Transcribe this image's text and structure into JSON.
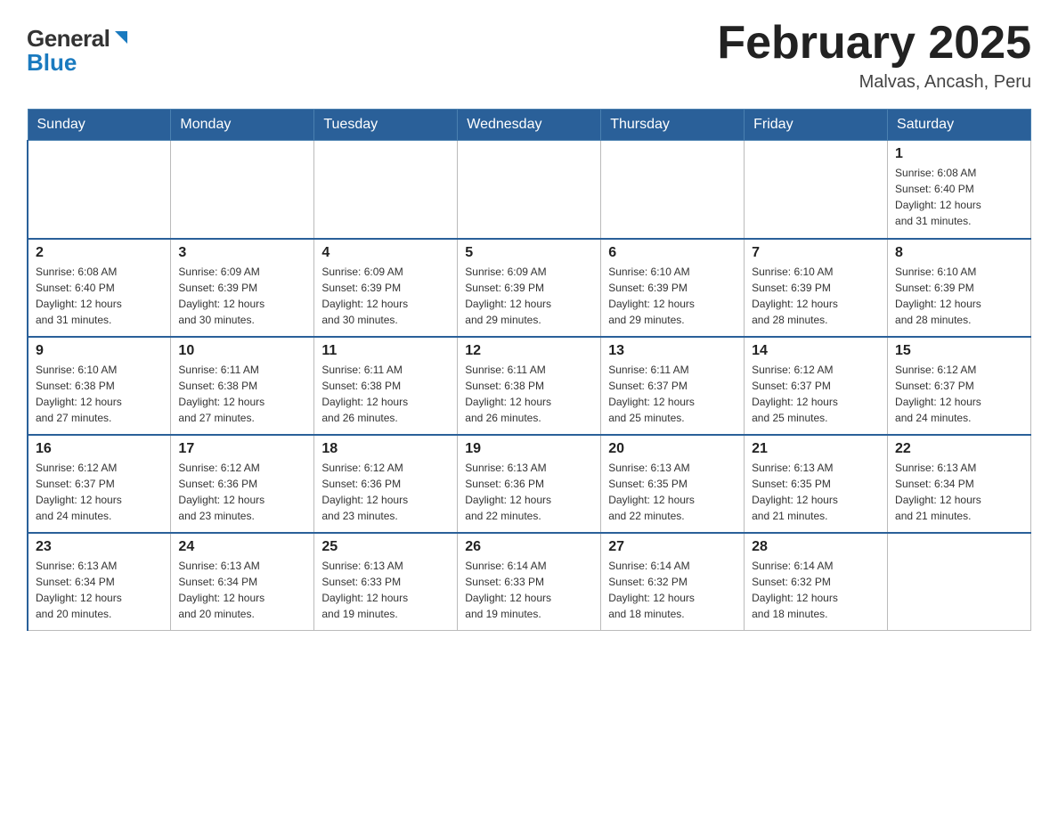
{
  "header": {
    "logo_line1": "General",
    "logo_line2": "Blue",
    "month_title": "February 2025",
    "location": "Malvas, Ancash, Peru"
  },
  "weekdays": [
    "Sunday",
    "Monday",
    "Tuesday",
    "Wednesday",
    "Thursday",
    "Friday",
    "Saturday"
  ],
  "weeks": [
    [
      {
        "day": "",
        "info": ""
      },
      {
        "day": "",
        "info": ""
      },
      {
        "day": "",
        "info": ""
      },
      {
        "day": "",
        "info": ""
      },
      {
        "day": "",
        "info": ""
      },
      {
        "day": "",
        "info": ""
      },
      {
        "day": "1",
        "info": "Sunrise: 6:08 AM\nSunset: 6:40 PM\nDaylight: 12 hours\nand 31 minutes."
      }
    ],
    [
      {
        "day": "2",
        "info": "Sunrise: 6:08 AM\nSunset: 6:40 PM\nDaylight: 12 hours\nand 31 minutes."
      },
      {
        "day": "3",
        "info": "Sunrise: 6:09 AM\nSunset: 6:39 PM\nDaylight: 12 hours\nand 30 minutes."
      },
      {
        "day": "4",
        "info": "Sunrise: 6:09 AM\nSunset: 6:39 PM\nDaylight: 12 hours\nand 30 minutes."
      },
      {
        "day": "5",
        "info": "Sunrise: 6:09 AM\nSunset: 6:39 PM\nDaylight: 12 hours\nand 29 minutes."
      },
      {
        "day": "6",
        "info": "Sunrise: 6:10 AM\nSunset: 6:39 PM\nDaylight: 12 hours\nand 29 minutes."
      },
      {
        "day": "7",
        "info": "Sunrise: 6:10 AM\nSunset: 6:39 PM\nDaylight: 12 hours\nand 28 minutes."
      },
      {
        "day": "8",
        "info": "Sunrise: 6:10 AM\nSunset: 6:39 PM\nDaylight: 12 hours\nand 28 minutes."
      }
    ],
    [
      {
        "day": "9",
        "info": "Sunrise: 6:10 AM\nSunset: 6:38 PM\nDaylight: 12 hours\nand 27 minutes."
      },
      {
        "day": "10",
        "info": "Sunrise: 6:11 AM\nSunset: 6:38 PM\nDaylight: 12 hours\nand 27 minutes."
      },
      {
        "day": "11",
        "info": "Sunrise: 6:11 AM\nSunset: 6:38 PM\nDaylight: 12 hours\nand 26 minutes."
      },
      {
        "day": "12",
        "info": "Sunrise: 6:11 AM\nSunset: 6:38 PM\nDaylight: 12 hours\nand 26 minutes."
      },
      {
        "day": "13",
        "info": "Sunrise: 6:11 AM\nSunset: 6:37 PM\nDaylight: 12 hours\nand 25 minutes."
      },
      {
        "day": "14",
        "info": "Sunrise: 6:12 AM\nSunset: 6:37 PM\nDaylight: 12 hours\nand 25 minutes."
      },
      {
        "day": "15",
        "info": "Sunrise: 6:12 AM\nSunset: 6:37 PM\nDaylight: 12 hours\nand 24 minutes."
      }
    ],
    [
      {
        "day": "16",
        "info": "Sunrise: 6:12 AM\nSunset: 6:37 PM\nDaylight: 12 hours\nand 24 minutes."
      },
      {
        "day": "17",
        "info": "Sunrise: 6:12 AM\nSunset: 6:36 PM\nDaylight: 12 hours\nand 23 minutes."
      },
      {
        "day": "18",
        "info": "Sunrise: 6:12 AM\nSunset: 6:36 PM\nDaylight: 12 hours\nand 23 minutes."
      },
      {
        "day": "19",
        "info": "Sunrise: 6:13 AM\nSunset: 6:36 PM\nDaylight: 12 hours\nand 22 minutes."
      },
      {
        "day": "20",
        "info": "Sunrise: 6:13 AM\nSunset: 6:35 PM\nDaylight: 12 hours\nand 22 minutes."
      },
      {
        "day": "21",
        "info": "Sunrise: 6:13 AM\nSunset: 6:35 PM\nDaylight: 12 hours\nand 21 minutes."
      },
      {
        "day": "22",
        "info": "Sunrise: 6:13 AM\nSunset: 6:34 PM\nDaylight: 12 hours\nand 21 minutes."
      }
    ],
    [
      {
        "day": "23",
        "info": "Sunrise: 6:13 AM\nSunset: 6:34 PM\nDaylight: 12 hours\nand 20 minutes."
      },
      {
        "day": "24",
        "info": "Sunrise: 6:13 AM\nSunset: 6:34 PM\nDaylight: 12 hours\nand 20 minutes."
      },
      {
        "day": "25",
        "info": "Sunrise: 6:13 AM\nSunset: 6:33 PM\nDaylight: 12 hours\nand 19 minutes."
      },
      {
        "day": "26",
        "info": "Sunrise: 6:14 AM\nSunset: 6:33 PM\nDaylight: 12 hours\nand 19 minutes."
      },
      {
        "day": "27",
        "info": "Sunrise: 6:14 AM\nSunset: 6:32 PM\nDaylight: 12 hours\nand 18 minutes."
      },
      {
        "day": "28",
        "info": "Sunrise: 6:14 AM\nSunset: 6:32 PM\nDaylight: 12 hours\nand 18 minutes."
      },
      {
        "day": "",
        "info": ""
      }
    ]
  ]
}
